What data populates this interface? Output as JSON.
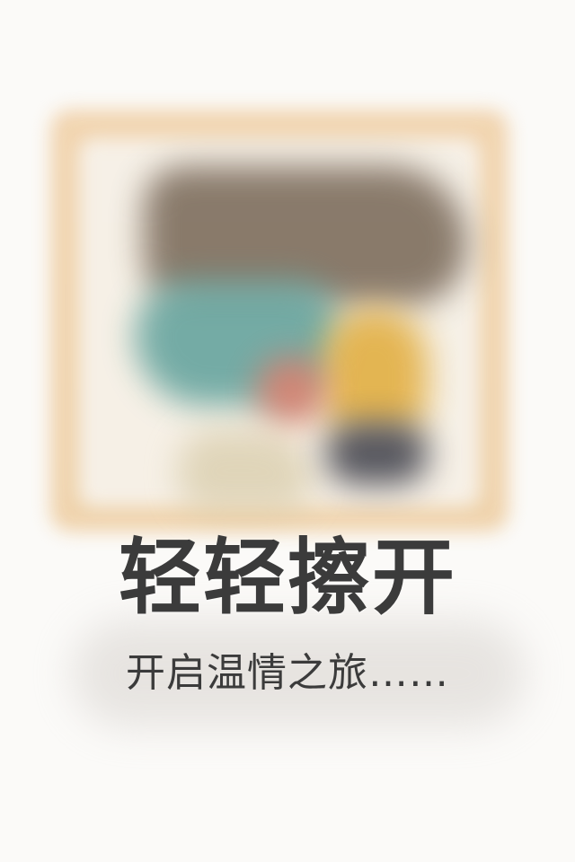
{
  "screen": {
    "headline": "轻轻擦开",
    "subline": "开启温情之旅……"
  },
  "style": {
    "text_color": "#3b3b3b",
    "background": "#fbfaf8",
    "frame_color": "#f1d3ad"
  }
}
